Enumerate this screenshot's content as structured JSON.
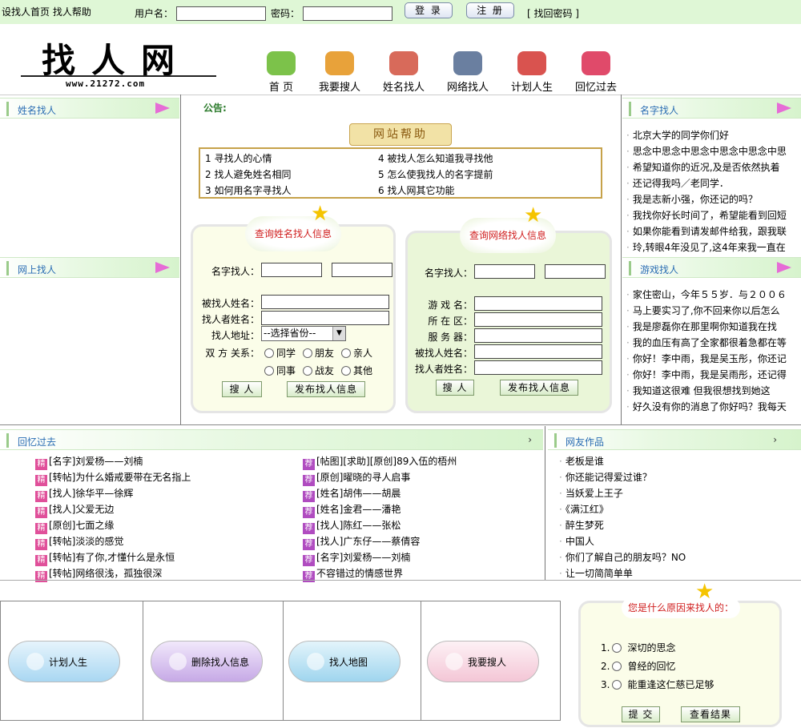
{
  "topbar": {
    "links": "设找人首页 找人帮助",
    "username_label": "用户名：",
    "password_label": "密码：",
    "login": "登 录",
    "register": "注 册",
    "find_password": "[ 找回密码 ]"
  },
  "logo": {
    "title": "找人网",
    "url": "www.21272.com"
  },
  "nav": [
    {
      "label": "首 页",
      "color": "#7cc24a"
    },
    {
      "label": "我要搜人",
      "color": "#e8a23a"
    },
    {
      "label": "姓名找人",
      "color": "#d86a5a"
    },
    {
      "label": "网络找人",
      "color": "#6a7fa0"
    },
    {
      "label": "计划人生",
      "color": "#d9534f"
    },
    {
      "label": "回忆过去",
      "color": "#e04a6a"
    }
  ],
  "left": {
    "head1": "姓名找人",
    "head2": "网上找人"
  },
  "center": {
    "notice_label": "公告:",
    "help_title": "网站帮助",
    "help_items": [
      "1 寻找人的心情",
      "2 找人避免姓名相同",
      "3 如何用名字寻找人",
      "4 被找人怎么知道我寻找他",
      "5 怎么使我找人的名字提前",
      "6 找人网其它功能"
    ]
  },
  "form1": {
    "title": "查询姓名找人信息",
    "name_label": "名字找人：",
    "target_label": "被找人姓名：",
    "seeker_label": "找人者姓名：",
    "addr_label": "找人地址：",
    "addr_select": "--选择省份--",
    "rel_label": "双 方 关系：",
    "relations": [
      "同学",
      "朋友",
      "亲人",
      "同事",
      "战友",
      "其他"
    ],
    "search": "搜 人",
    "publish": "发布找人信息"
  },
  "form2": {
    "title": "查询网络找人信息",
    "name_label": "名字找人：",
    "fields": [
      "游 戏 名：",
      "所 在 区：",
      "服 务 器：",
      "被找人姓名：",
      "找人者姓名："
    ],
    "search": "搜 人",
    "publish": "发布找人信息"
  },
  "right": {
    "head1": "名字找人",
    "names": [
      "北京大学的同学你们好",
      "思念中思念中思念中思念中思念中思",
      "希望知道你的近况,及是否依然执着",
      "还记得我吗／老同学．",
      "我是志新小强，你还记的吗？",
      "我找你好长时间了，希望能看到回短",
      "如果你能看到请发邮件给我，跟我联",
      "玲,转眼4年没见了,这4年来我一直在"
    ],
    "head2": "游戏找人",
    "games": [
      "家住密山，今年５５岁．与２００６",
      "马上要实习了,你不回来你以后怎么",
      "我是廖磊你在那里啊你知道我在找",
      "我的血压有高了全家都很着急都在等",
      "你好！李中雨，我是吴玉彤，你还记",
      "你好！李中雨，我是吴雨彤，还记得",
      "我知道这很难 但我很想找到她这",
      "好久没有你的消息了你好吗？我每天"
    ]
  },
  "memory": {
    "head": "回忆过去",
    "more": "›",
    "tag_j": "精",
    "tag_t": "荐",
    "col1": [
      "[名字]刘爱杨——刘楠",
      "[转帖]为什么婚戒要带在无名指上",
      "[找人]徐华平—徐辉",
      "[找人]父爱无边",
      "[原创]七面之缘",
      "[转帖]淡淡的感觉",
      "[转帖]有了你,才懂什么是永恒",
      "[转帖]网络很浅，孤独很深"
    ],
    "col2": [
      "[帖图][求助][原创]89入伍的梧州",
      "[原创]曜晓的寻人启事",
      "[姓名]胡伟——胡晨",
      "[姓名]金君——潘艳",
      "[找人]陈红——张松",
      "[找人]广东仔——蔡倩容",
      "[名字]刘爱杨——刘楠",
      "不容错过的情感世界"
    ]
  },
  "works": {
    "head": "网友作品",
    "more": "›",
    "items": [
      "老板是谁",
      "你还能记得爱过谁？",
      "当妖爱上王子",
      "《满江红》",
      "醉生梦死",
      "中国人",
      "你们了解自己的朋友吗？NO",
      "让一切简简单单"
    ]
  },
  "bottom": {
    "buttons": [
      {
        "label": "计划人生",
        "color": "#a9d7f2"
      },
      {
        "label": "删除找人信息",
        "color": "#c6a9e6"
      },
      {
        "label": "找人地图",
        "color": "#9fd5ee"
      },
      {
        "label": "我要搜人",
        "color": "#f4c6d6"
      }
    ]
  },
  "poll": {
    "title": "您是什么原因来找人的：",
    "options": [
      "1.",
      "2.",
      "3."
    ],
    "option_texts": [
      "深切的思念",
      "曾经的回忆",
      "能重逢这仁慈已足够"
    ],
    "submit": "提 交",
    "results": "查看结果"
  }
}
